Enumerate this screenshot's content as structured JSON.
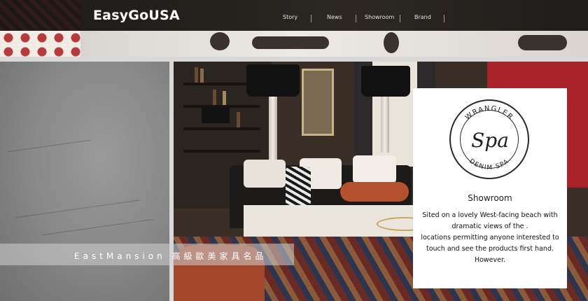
{
  "header": {
    "logo": "EasyGoUSA",
    "nav": [
      {
        "label": "Story"
      },
      {
        "label": "News"
      },
      {
        "label": "Showroom"
      },
      {
        "label": "Brand"
      }
    ]
  },
  "caption": {
    "brand_text": "EastMansion 高級歐美家具名品"
  },
  "showroom_card": {
    "seal_top_text": "WRANGLER",
    "seal_center_text": "Spa",
    "seal_bottom_text": "DENIM SPA",
    "title": "Showroom",
    "body_lines": [
      "Sited on a lovely West-facing beach with",
      "dramatic views of the .",
      "locations permitting anyone interested to",
      "touch and see the products first hand.",
      "However."
    ]
  },
  "colors": {
    "header_bg": "#2f2a27",
    "accent_red": "#a8232a",
    "card_bg": "#ffffff",
    "left_panel": "#8a8a8a"
  },
  "icons": {
    "seal": "wrangler-spa-seal-icon"
  }
}
